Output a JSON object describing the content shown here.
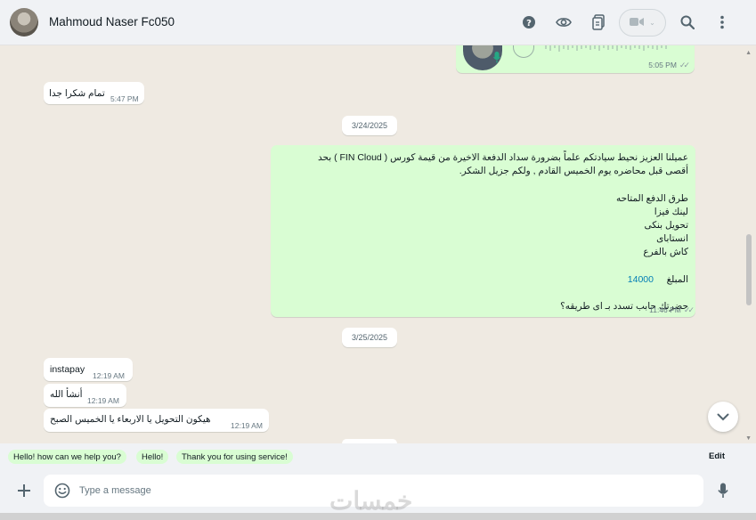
{
  "header": {
    "contact_name": "Mahmoud Naser Fc050",
    "icons": [
      "help-icon",
      "eye-icon",
      "clipboard-icon",
      "video-camera-icon",
      "search-icon",
      "more-icon"
    ]
  },
  "messages": {
    "voice": {
      "time": "5:05 PM",
      "ticks": "✓✓"
    },
    "thanks": {
      "text": "تمام شكرا جدا",
      "time": "5:47 PM"
    },
    "date1": "3/24/2025",
    "long": {
      "lines": [
        "عميلنا العزيز نحيط سيادتكم علماً بضرورة سداد الدفعة الاخيرة من قيمة كورس ( FIN  Cloud ) بحد",
        "أقصى قبل محاضره يوم  الخميس  القادم , ولكم جزيل الشكر.",
        "",
        "طرق الدفع المتاحه",
        "لينك  فيزا",
        "تحويل بنكى",
        "انستاباى",
        "كاش بالفرع",
        ""
      ],
      "amount_label": "المبلغ",
      "amount_value": "14000",
      "question": "حضرتك حابب تسدد بـ اى طريقه؟",
      "time": "11:46 PM",
      "ticks": "✓✓"
    },
    "date2": "3/25/2025",
    "instapay": {
      "text": "instapay",
      "time": "12:19 AM"
    },
    "inshallah": {
      "text": "أنشأ الله",
      "time": "12:19 AM"
    },
    "transfer": {
      "text": "هيكون التحويل يا  الاربعاء يا الخميس الصبح",
      "time": "12:19 AM"
    }
  },
  "quick_replies": {
    "items": [
      "Hello! how can we help you?",
      "Hello!",
      "Thank you for using service!"
    ],
    "edit_label": "Edit"
  },
  "composer": {
    "placeholder": "Type a message"
  },
  "watermark": "خمسات",
  "colors": {
    "outgoing_bubble": "#d9fdd3",
    "incoming_bubble": "#ffffff",
    "chat_background": "#efeae2",
    "link_blue": "#027eb5"
  }
}
